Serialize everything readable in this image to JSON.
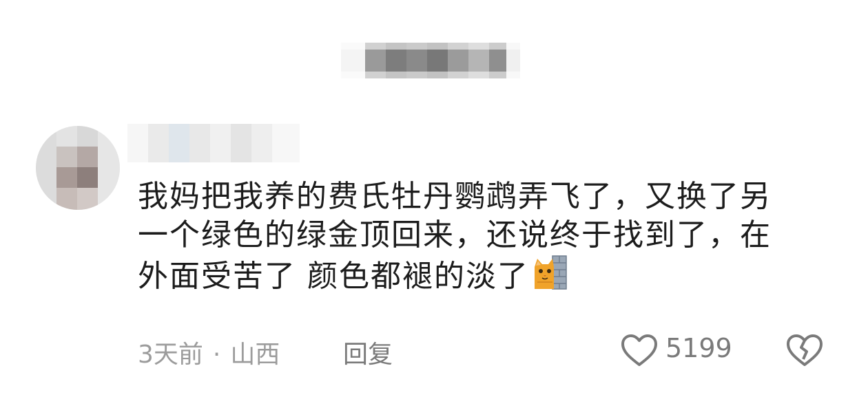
{
  "comment": {
    "lines": [
      "我妈把我养的费氏牡丹鹦鹉弄飞了，又换了另",
      "一个绿色的绿金顶回来，还说终于找到了，在",
      "外面受苦了 颜色都褪的淡了"
    ],
    "emoji": "cat-behind-wall-emoji"
  },
  "meta": {
    "time": "3天前",
    "separator": "·",
    "location": "山西",
    "reply_label": "回复"
  },
  "actions": {
    "like_count": "5199",
    "like_icon": "heart-outline-icon",
    "dislike_icon": "broken-heart-icon"
  }
}
